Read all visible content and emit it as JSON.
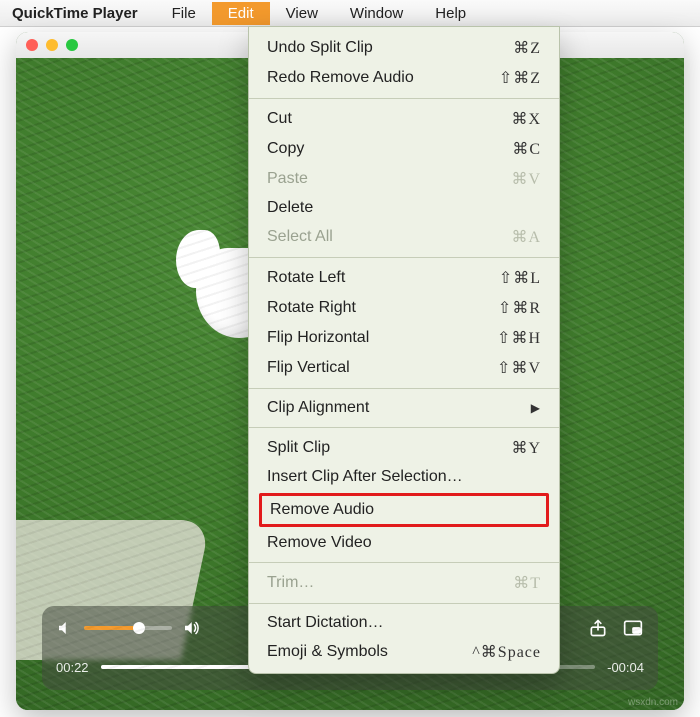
{
  "menubar": {
    "app": "QuickTime Player",
    "items": [
      "File",
      "Edit",
      "View",
      "Window",
      "Help"
    ],
    "active_index": 1
  },
  "edit_menu": {
    "undo": {
      "label": "Undo Split Clip",
      "shortcut": "⌘Z"
    },
    "redo": {
      "label": "Redo Remove Audio",
      "shortcut": "⇧⌘Z"
    },
    "cut": {
      "label": "Cut",
      "shortcut": "⌘X"
    },
    "copy": {
      "label": "Copy",
      "shortcut": "⌘C"
    },
    "paste": {
      "label": "Paste",
      "shortcut": "⌘V"
    },
    "delete": {
      "label": "Delete",
      "shortcut": ""
    },
    "selall": {
      "label": "Select All",
      "shortcut": "⌘A"
    },
    "rotl": {
      "label": "Rotate Left",
      "shortcut": "⇧⌘L"
    },
    "rotr": {
      "label": "Rotate Right",
      "shortcut": "⇧⌘R"
    },
    "fliph": {
      "label": "Flip Horizontal",
      "shortcut": "⇧⌘H"
    },
    "flipv": {
      "label": "Flip Vertical",
      "shortcut": "⇧⌘V"
    },
    "align": {
      "label": "Clip Alignment",
      "shortcut": "▶"
    },
    "split": {
      "label": "Split Clip",
      "shortcut": "⌘Y"
    },
    "insert": {
      "label": "Insert Clip After Selection…",
      "shortcut": ""
    },
    "rmaud": {
      "label": "Remove Audio",
      "shortcut": ""
    },
    "rmvid": {
      "label": "Remove Video",
      "shortcut": ""
    },
    "trim": {
      "label": "Trim…",
      "shortcut": "⌘T"
    },
    "dict": {
      "label": "Start Dictation…",
      "shortcut": ""
    },
    "emoji": {
      "label": "Emoji & Symbols",
      "shortcut": "^⌘Space"
    }
  },
  "player": {
    "elapsed": "00:22",
    "remaining": "-00:04",
    "volume_pct": 62,
    "progress_pct": 85
  },
  "watermark": "wsxdn.com"
}
